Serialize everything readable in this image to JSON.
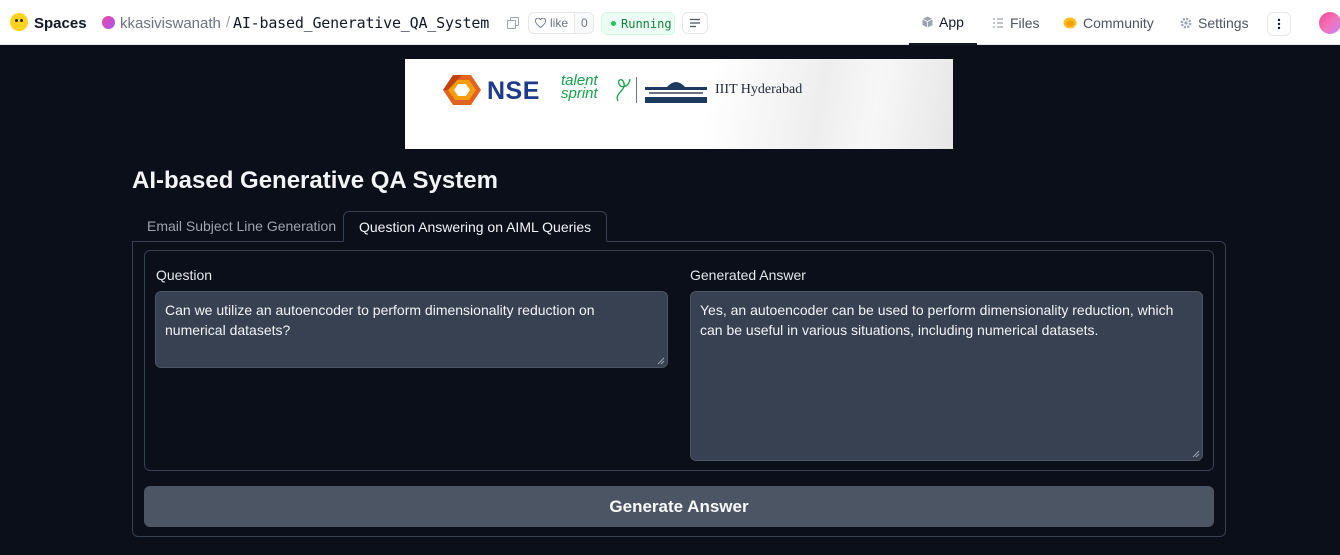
{
  "header": {
    "spaces_label": "Spaces",
    "owner": "kkasiviswanath",
    "separator": "/",
    "repo_name": "AI-based_Generative_QA_System",
    "like_label": "like",
    "like_count": "0",
    "status": "Running",
    "nav": {
      "app": "App",
      "files": "Files",
      "community": "Community",
      "settings": "Settings"
    }
  },
  "banner": {
    "nse": "NSE",
    "talent": "talent",
    "sprint": "sprint",
    "iiit": "IIIT Hyderabad"
  },
  "app": {
    "title": "AI-based Generative QA System",
    "tabs": [
      {
        "label": "Email Subject Line Generation",
        "active": false
      },
      {
        "label": "Question Answering on AIML Queries",
        "active": true
      }
    ],
    "question_label": "Question",
    "question_value": "Can we utilize an autoencoder to perform dimensionality reduction on numerical datasets?",
    "answer_label": "Generated Answer",
    "answer_value": "Yes, an autoencoder can be used to perform dimensionality reduction, which can be useful in various situations, including numerical datasets.",
    "generate_button": "Generate Answer"
  },
  "colors": {
    "background": "#0b0f19",
    "panel_border": "#374151",
    "textarea_bg": "#374151",
    "button_bg": "#4b5563",
    "status_green": "#22c55e"
  }
}
